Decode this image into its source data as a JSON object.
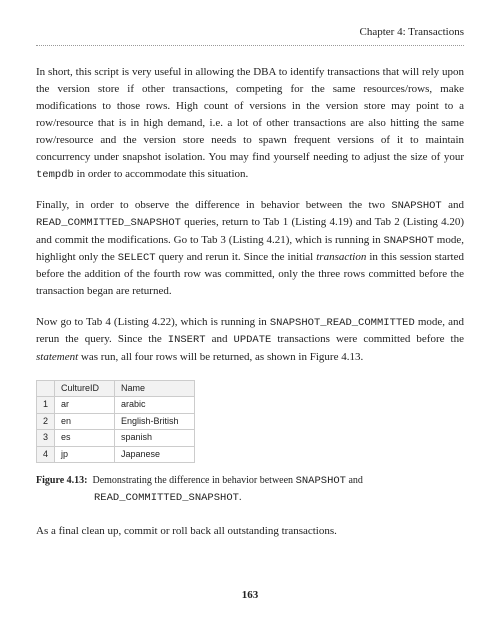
{
  "header": {
    "chapter": "Chapter 4: Transactions"
  },
  "paragraphs": {
    "p1a": "In short, this script is very useful in allowing the DBA to identify transactions that will rely upon the version store if other transactions, competing for the same resources/rows, make modifications to those rows. High count of versions in the version store may point to a row/resource that is in high demand, i.e. a lot of other transactions are also hitting the same row/resource and the version store needs to spawn frequent versions of it to maintain concurrency under snapshot isolation. You may find yourself needing to adjust the size of your ",
    "p1b": "tempdb",
    "p1c": " in order to accommodate this situation.",
    "p2a": "Finally, in order to observe the difference in behavior between the two ",
    "p2b": "SNAPSHOT",
    "p2c": " and ",
    "p2d": "READ_COMMITTED_SNAPSHOT",
    "p2e": " queries, return to Tab 1 (Listing 4.19) and Tab 2 (Listing 4.20) and commit the modifications. Go to Tab 3 (Listing 4.21), which is running in ",
    "p2f": "SNAPSHOT",
    "p2g": " mode, highlight only the ",
    "p2h": "SELECT",
    "p2i": " query and rerun it. Since the initial ",
    "p2j": "transaction",
    "p2k": " in this session started before the addition of the fourth row was committed, only the three rows committed before the transaction began are returned.",
    "p3a": "Now go to Tab 4 (Listing 4.22), which is running in ",
    "p3b": "SNAPSHOT_READ_COMMITTED",
    "p3c": " mode, and rerun the query. Since the ",
    "p3d": "INSERT",
    "p3e": " and ",
    "p3f": "UPDATE",
    "p3g": " transactions were committed before the ",
    "p3h": "statement",
    "p3i": " was run, all four rows will be returned, as shown in Figure 4.13.",
    "p4": "As a final clean up, commit or roll back all outstanding transactions."
  },
  "table": {
    "headers": {
      "h0": "",
      "h1": "CultureID",
      "h2": "Name"
    },
    "rows": [
      {
        "n": "1",
        "cid": "ar",
        "name": "arabic"
      },
      {
        "n": "2",
        "cid": "en",
        "name": "English-British"
      },
      {
        "n": "3",
        "cid": "es",
        "name": "spanish"
      },
      {
        "n": "4",
        "cid": "jp",
        "name": "Japanese"
      }
    ]
  },
  "figure": {
    "label": "Figure 4.13:",
    "cap_a": "Demonstrating the difference in behavior between ",
    "cap_b": "SNAPSHOT",
    "cap_c": " and ",
    "cap_d": "READ_COMMITTED_SNAPSHOT",
    "cap_e": "."
  },
  "pagenum": "163"
}
